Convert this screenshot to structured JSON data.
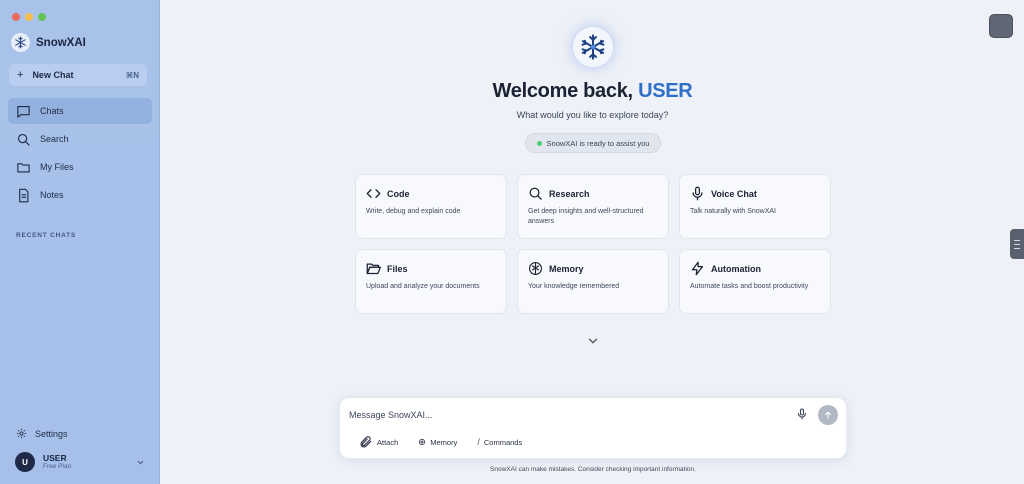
{
  "window": {
    "controls": [
      "close",
      "minimize",
      "maximize"
    ]
  },
  "sidebar": {
    "brand": "SnowXAI",
    "new_chat": {
      "label": "New Chat",
      "shortcut": "⌘N"
    },
    "items": [
      {
        "label": "Chats",
        "icon": "chat-bubble-icon",
        "active": true
      },
      {
        "label": "Search",
        "icon": "search-icon",
        "active": false
      },
      {
        "label": "My Files",
        "icon": "folder-icon",
        "active": false
      },
      {
        "label": "Notes",
        "icon": "note-icon",
        "active": false
      }
    ],
    "recent_heading": "RECENT CHATS",
    "settings_label": "Settings",
    "user": {
      "initial": "U",
      "name": "USER",
      "plan": "Free Plan"
    }
  },
  "main": {
    "welcome_prefix": "Welcome back,",
    "welcome_name": "USER",
    "subtitle": "What would you like to explore today?",
    "status": "SnowXAI is ready to assist you",
    "cards": [
      {
        "title": "Code",
        "desc": "Write, debug and explain code",
        "icon": "code-icon"
      },
      {
        "title": "Research",
        "desc": "Get deep insights and well-structured answers",
        "icon": "search-icon"
      },
      {
        "title": "Voice Chat",
        "desc": "Talk naturally with SnowXAI",
        "icon": "microphone-icon"
      },
      {
        "title": "Files",
        "desc": "Upload and analyze your documents",
        "icon": "folder-open-icon"
      },
      {
        "title": "Memory",
        "desc": "Your knowledge remembered",
        "icon": "brain-icon"
      },
      {
        "title": "Automation",
        "desc": "Automate tasks and boost productivity",
        "icon": "lightning-icon"
      }
    ]
  },
  "composer": {
    "placeholder": "Message SnowXAI...",
    "tools": {
      "attach": "Attach",
      "memory": "Memory",
      "commands": "Commands"
    }
  },
  "disclaimer": "SnowXAI can make mistakes. Consider checking important information.",
  "colors": {
    "accent": "#2f6fc9",
    "sidebar": "#a9c2ea",
    "status_dot": "#4ccf74",
    "avatar": "#1e2a48"
  }
}
